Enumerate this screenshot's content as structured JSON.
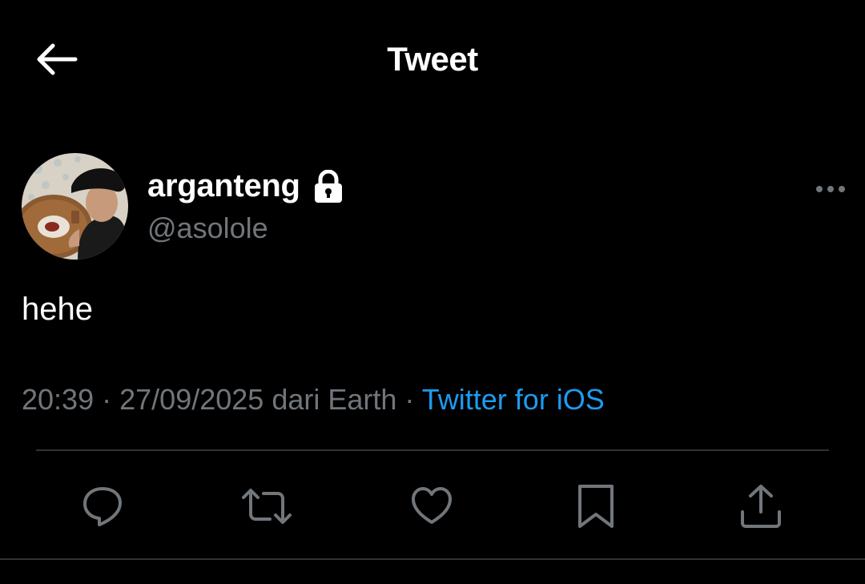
{
  "header": {
    "title": "Tweet",
    "back_icon": "arrow-left-icon"
  },
  "author": {
    "display_name": "arganteng",
    "handle": "@asolole",
    "protected_icon": "lock-icon",
    "avatar": "profile-photo"
  },
  "tweet": {
    "text": "hehe",
    "time": "20:39",
    "date": "27/09/2025",
    "location_text": "dari Earth",
    "separator": "·",
    "source": "Twitter for iOS"
  },
  "more_menu_icon": "more-horizontal-icon",
  "actions": [
    {
      "name": "reply",
      "icon": "reply-icon"
    },
    {
      "name": "retweet",
      "icon": "retweet-icon"
    },
    {
      "name": "like",
      "icon": "heart-icon"
    },
    {
      "name": "bookmark",
      "icon": "bookmark-icon"
    },
    {
      "name": "share",
      "icon": "share-icon"
    }
  ],
  "colors": {
    "background": "#000000",
    "text_primary": "#ffffff",
    "text_secondary": "#71767b",
    "link": "#1d9bf0",
    "divider": "#2f3336"
  }
}
